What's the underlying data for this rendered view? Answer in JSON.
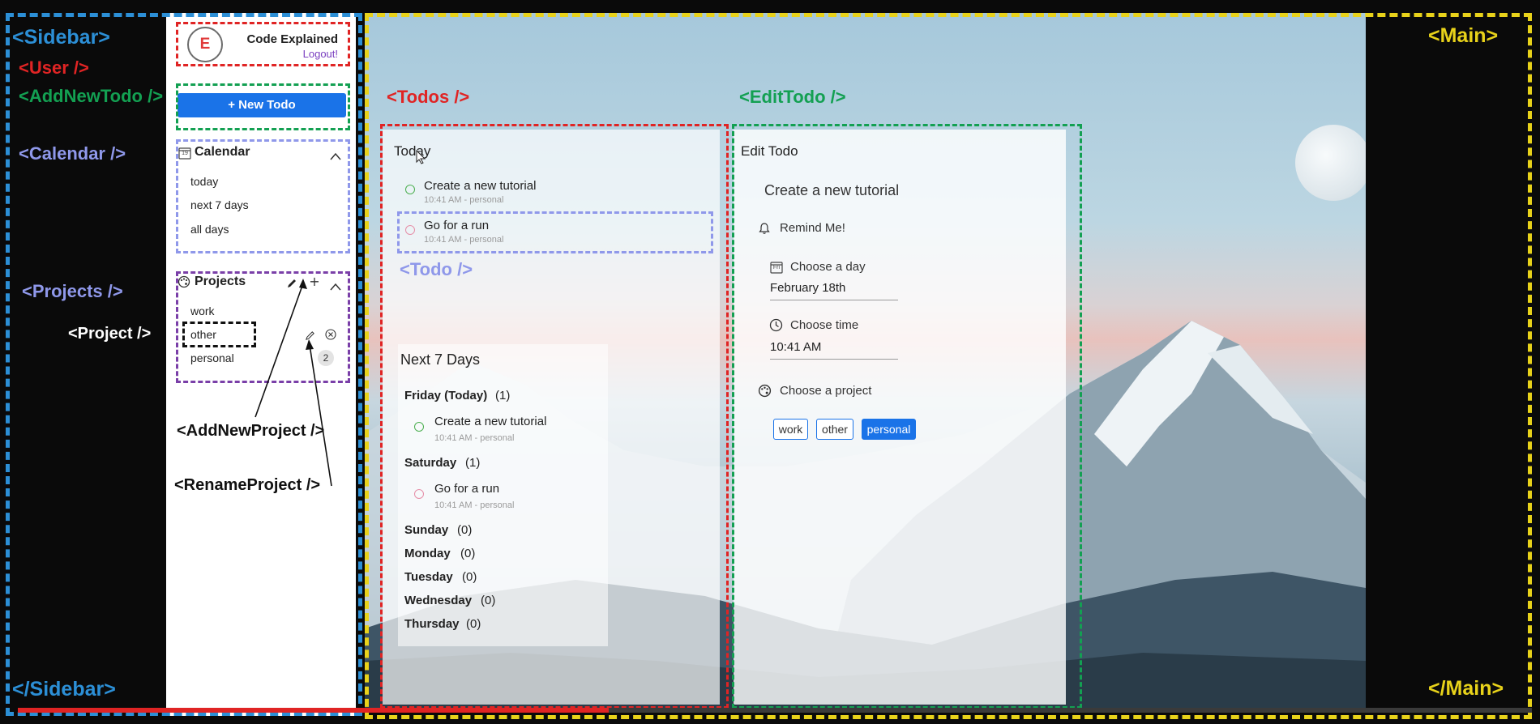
{
  "user": {
    "name": "Code Explained",
    "logout_label": "Logout!",
    "avatar_letter": "E"
  },
  "add_new_todo": {
    "label": "+ New Todo"
  },
  "calendar": {
    "title": "Calendar",
    "icon_day": "19",
    "items": [
      {
        "label": "today"
      },
      {
        "label": "next 7 days"
      },
      {
        "label": "all days"
      }
    ]
  },
  "projects": {
    "title": "Projects",
    "items": [
      {
        "label": "work"
      },
      {
        "label": "other"
      },
      {
        "label": "personal",
        "count": "2"
      }
    ]
  },
  "todos": {
    "today_title": "Today",
    "today_items": [
      {
        "text": "Create a new tutorial",
        "meta": "10:41 AM - personal",
        "color": "#4caf50"
      },
      {
        "text": "Go for a run",
        "meta": "10:41 AM - personal",
        "color": "#e68fa8"
      }
    ],
    "next7_title": "Next 7 Days",
    "days": [
      {
        "name": "Friday (Today)",
        "count": "(1)",
        "items": [
          {
            "text": "Create a new tutorial",
            "meta": "10:41 AM - personal",
            "color": "#4caf50"
          }
        ]
      },
      {
        "name": "Saturday",
        "count": "(1)",
        "items": [
          {
            "text": "Go for a run",
            "meta": "10:41 AM - personal",
            "color": "#e68fa8"
          }
        ]
      },
      {
        "name": "Sunday",
        "count": "(0)"
      },
      {
        "name": "Monday",
        "count": "(0)"
      },
      {
        "name": "Tuesday",
        "count": "(0)"
      },
      {
        "name": "Wednesday",
        "count": "(0)"
      },
      {
        "name": "Thursday",
        "count": "(0)"
      }
    ]
  },
  "edit_todo": {
    "title": "Edit Todo",
    "todo_text": "Create a new tutorial",
    "remind_label": "Remind Me!",
    "day_label": "Choose a day",
    "day_icon_text": "Fri",
    "day_value": "February 18th",
    "time_label": "Choose time",
    "time_value": "10:41 AM",
    "project_label": "Choose a project",
    "projects": [
      {
        "label": "work",
        "selected": false
      },
      {
        "label": "other",
        "selected": false
      },
      {
        "label": "personal",
        "selected": true
      }
    ]
  },
  "annotations": {
    "sidebar_open": "<Sidebar>",
    "sidebar_close": "</Sidebar>",
    "user": "<User />",
    "add_new_todo": "<AddNewTodo />",
    "calendar": "<Calendar />",
    "projects": "<Projects />",
    "project": "<Project />",
    "add_new_project": "<AddNewProject />",
    "rename_project": "<RenameProject />",
    "todos": "<Todos />",
    "todo": "<Todo />",
    "edit_todo": "<EditTodo />",
    "main_open": "<Main>",
    "main_close": "</Main>"
  },
  "video_progress": 0.39,
  "colors": {
    "sidebar_blue": "#2c8fd6",
    "user_red": "#e02424",
    "green": "#13a052",
    "lavender": "#8f98ea",
    "purple": "#7a3fa8",
    "yellow": "#e8d21a",
    "accent_blue": "#1a73e8"
  }
}
